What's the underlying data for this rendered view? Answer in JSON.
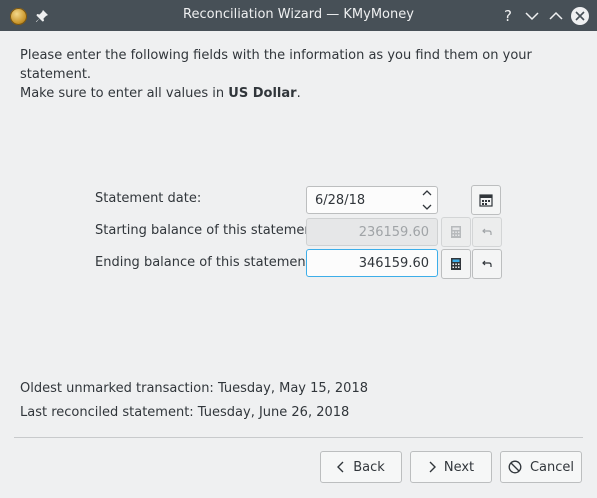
{
  "window": {
    "title": "Reconciliation Wizard — KMyMoney"
  },
  "intro": {
    "line1": "Please enter the following fields with the information as you find them on your statement.",
    "line2_prefix": "Make sure to enter all values in ",
    "line2_currency": "US Dollar",
    "line2_suffix": "."
  },
  "form": {
    "statement_date": {
      "label": "Statement date:",
      "value": "6/28/18"
    },
    "starting_balance": {
      "label": "Starting balance of this statement:",
      "value": "236159.60",
      "enabled": false
    },
    "ending_balance": {
      "label": "Ending balance of this statement:",
      "value": "346159.60",
      "focused": true
    }
  },
  "info": {
    "oldest_unmarked": "Oldest unmarked transaction: Tuesday, May 15, 2018",
    "last_reconciled": "Last reconciled statement: Tuesday, June 26, 2018"
  },
  "buttons": {
    "back": "Back",
    "next": "Next",
    "cancel": "Cancel"
  },
  "icons": [
    "app-coin-icon",
    "pin-icon",
    "help-icon",
    "minimize-icon",
    "maximize-icon",
    "close-icon",
    "spin-up-icon",
    "spin-down-icon",
    "calendar-icon",
    "calculator-icon",
    "undo-icon",
    "chevron-left-icon",
    "chevron-right-icon",
    "cancel-icon"
  ],
  "colors": {
    "titlebar": "#475057",
    "focus": "#3daee9",
    "window_bg": "#eff0f1"
  }
}
